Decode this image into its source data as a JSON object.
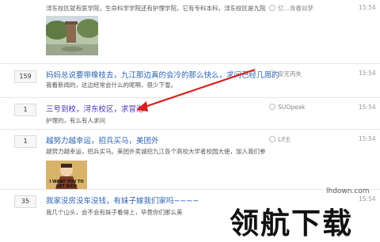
{
  "threads": [
    {
      "count": "",
      "title": "",
      "snippet": "浔东校区就有医学院，生命科学学院还有护理学院，它有专科本科，浔东校区是九院",
      "author": "忆…青春如梦",
      "time": "15:54",
      "has_image": true
    },
    {
      "count": "159",
      "title": "妈妈总说要带橡枝去，九江那边真的会冷的那么快么，求问已经几周的",
      "snippet": "我看新闻的，这边经常会什么的呢啊，很少下雪。",
      "author": "安无丙失",
      "time": "15:54",
      "has_image": false
    },
    {
      "count": "1",
      "title": "三号到校，浔东校区，求冒泡",
      "snippet": "护理的，有么有人求问",
      "author": "SUOpeak",
      "time": "15:54",
      "has_image": false,
      "visited": true
    },
    {
      "count": "1",
      "title": "越努力越幸运，招兵买马，美团外",
      "snippet": "越努力越幸运，招兵买马。美团外卖诚招九江各个高校大学者校园大使，加入我们参",
      "author": "Lif主",
      "time": "15:54",
      "has_image": true,
      "image_caption": "I WANT YOU TO GET RICH"
    },
    {
      "count": "35",
      "title": "我家没房没车没钱，有妹子嫁我们家吗~~~~",
      "snippet": "我几个山头，会不会有妹子看得上，毕竟你们那么美",
      "author": "",
      "time": "15:54",
      "has_image": false
    }
  ],
  "watermark": {
    "text": "领航下载",
    "url": "lhdown.com"
  },
  "colors": {
    "link": "#2d64b3",
    "visited_link": "#4a2fb8",
    "arrow": "#d91e1e"
  }
}
